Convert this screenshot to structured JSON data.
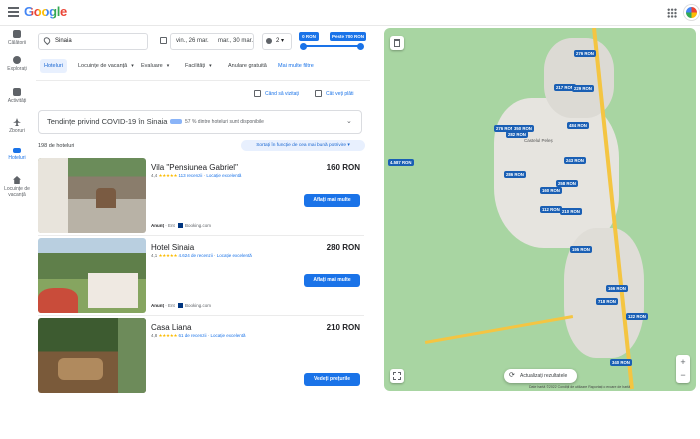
{
  "header": {
    "logo": "Google"
  },
  "nav": [
    {
      "label": "Călătorii"
    },
    {
      "label": "Explorați"
    },
    {
      "label": "Activități"
    },
    {
      "label": "Zboruri"
    },
    {
      "label": "Hoteluri"
    },
    {
      "label": "Locuințe de vacanță"
    }
  ],
  "search": {
    "location": "Sinaia",
    "checkin": "vin., 26 mar.",
    "checkout": "mar., 30 mar.",
    "guests": "2"
  },
  "price": {
    "min": "0 RON",
    "max": "Peste 700 RON"
  },
  "filters": [
    {
      "label": "Hoteluri"
    },
    {
      "label": "Locuințe de vacanță"
    },
    {
      "label": "Evaluare"
    },
    {
      "label": "Facilități"
    },
    {
      "label": "Anulare gratuită"
    },
    {
      "label": "Mai multe filtre"
    }
  ],
  "tools": {
    "when": "Când să vizitați",
    "where": "Cât veți plăti"
  },
  "covid": {
    "title": "Tendințe privind COVID-19 în Sinaia",
    "sub": "57 % dintre hoteluri sunt disponibile"
  },
  "results": {
    "count": "198 de hoteluri",
    "sort": "Sortați în funcție de cea mai bună potrivire"
  },
  "hotels": [
    {
      "name": "Vila \"Pensiunea Gabriel\"",
      "price": "160 RON",
      "rating": "4,4",
      "stars": "★★★★★",
      "reviews": "113 recenzii",
      "location": "Locație excelentă",
      "button": "Aflați mai multe",
      "ad": "Anunț",
      "source": "Booking.com"
    },
    {
      "name": "Hotel Sinaia",
      "price": "280 RON",
      "rating": "4,1",
      "stars": "★★★★★",
      "reviews": "4.624 de recenzii",
      "location": "Locație excelentă",
      "button": "Aflați mai multe",
      "ad": "Anunț",
      "source": "Booking.com"
    },
    {
      "name": "Casa Liana",
      "price": "210 RON",
      "rating": "4,8",
      "stars": "★★★★★",
      "reviews": "61 de recenzii",
      "location": "Locație excelentă",
      "button": "Vedeți prețurile"
    }
  ],
  "map": {
    "refresh": "Actualizați rezultatele",
    "footer": "Date hartă ©2022   Condiții de utilizare   Raportați o eroare de hartă",
    "place": "Castelul Peleș",
    "pins": [
      "276 RON",
      "217 RON",
      "229 RON",
      "276 RON",
      "350 RON",
      "282 RON",
      "484 RON",
      "4.587 RON",
      "243 RON",
      "286 RON",
      "258 RON",
      "160 RON",
      "112 RON",
      "210 RON",
      "195 RON",
      "166 RON",
      "718 RON",
      "122 RON",
      "340 RON"
    ]
  },
  "colors": {
    "accent": "#1a73e8",
    "pin": "#1a5fb4",
    "map": "#a8d5a2"
  }
}
